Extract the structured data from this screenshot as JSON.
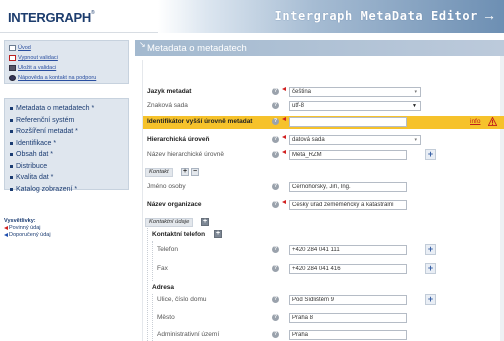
{
  "app": {
    "logo": "INTERGRAPH",
    "logo_mark": "®",
    "title": "Intergraph MetaData Editor",
    "title_arrow": "→"
  },
  "quick_links": [
    {
      "label": "Úvod",
      "icon": "home-icon"
    },
    {
      "label": "Vypnout validaci",
      "icon": "validation-off-icon"
    },
    {
      "label": "Uložit a validaci",
      "icon": "save-icon"
    },
    {
      "label": "Nápověda a kontakt na podporu",
      "icon": "info-icon"
    }
  ],
  "nav": [
    {
      "label": "Metadata o metadatech *"
    },
    {
      "label": "Referenční systém"
    },
    {
      "label": "Rozšíření metadat *"
    },
    {
      "label": "Identifikace *"
    },
    {
      "label": "Obsah dat *"
    },
    {
      "label": "Distribuce"
    },
    {
      "label": "Kvalita dat *"
    },
    {
      "label": "Katalog zobrazení *"
    }
  ],
  "legend": {
    "title": "Vysvětlivky:",
    "items": [
      "Povinný údaj",
      "Doporučený údaj"
    ]
  },
  "panel": {
    "title": "Metadata o metadatech"
  },
  "form": {
    "jazyk": {
      "label": "Jazyk metadat",
      "value": "čeština"
    },
    "znakova": {
      "label": "Znaková sada",
      "value": "utf-8"
    },
    "identifikator": {
      "label": "Identifikátor vyšší úrovně metadat",
      "value": "",
      "info": "info"
    },
    "hierarchicka": {
      "label": "Hierarchická úroveň",
      "value": "datová sada"
    },
    "nazev_hier": {
      "label": "Název hierarchické úrovně",
      "value": "Meta_RZM"
    },
    "kontakt_group": {
      "label": "Kontakt",
      "add": "+",
      "remove": "−"
    },
    "jmeno": {
      "label": "Jméno osoby",
      "value": "Černohorský, Jiří, Ing."
    },
    "organizace": {
      "label": "Název organizace",
      "value": "Český úřad zeměměřický a katastrální"
    },
    "kontaktni_group": {
      "label": "Kontaktní údaje",
      "add": "+"
    },
    "kontaktni_telefon": {
      "label": "Kontaktní telefon",
      "add": "+"
    },
    "telefon": {
      "label": "Telefon",
      "value": "+420 284 041 111"
    },
    "fax": {
      "label": "Fax",
      "value": "+420 284 041 416"
    },
    "adresa": {
      "label": "Adresa"
    },
    "ulice": {
      "label": "Ulice, číslo domu",
      "value": "Pod Sídlištěm 9"
    },
    "mesto": {
      "label": "Město",
      "value": "Praha 8"
    },
    "uzemi": {
      "label": "Administrativní území",
      "value": "Praha"
    },
    "add_symbol": "+"
  },
  "colors": {
    "highlight": "#f6c22b",
    "required": "#d12020",
    "recommended": "#2050b0",
    "nav_bg": "#dfe6ee"
  }
}
